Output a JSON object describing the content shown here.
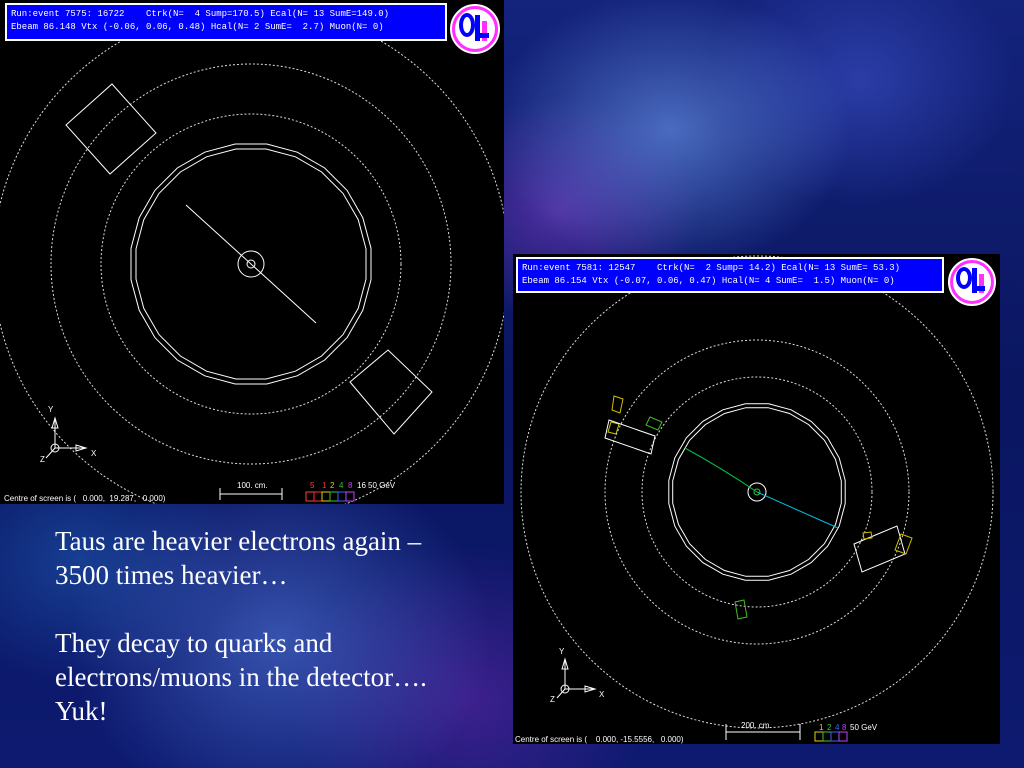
{
  "slide": {
    "paragraphs": [
      "Taus are heavier electrons again – 3500 times heavier…",
      "They decay to quarks and electrons/muons in the detector…. Yuk!"
    ]
  },
  "event1": {
    "header_line1": "Run:event 7575: 16722    Ctrk(N=  4 Sump=170.5) Ecal(N= 13 SumE=149.0)",
    "header_line2": "Ebeam 86.148 Vtx (-0.06, 0.06, 0.48) Hcal(N= 2 SumE=  2.7) Muon(N= 0)",
    "centre_of_screen": "Centre of screen is (   0.000,  19.287,   0.000)",
    "scale_label": "100. cm.",
    "energy_scale": [
      "5",
      "1",
      "2",
      "4",
      "8",
      "16",
      "50 GeV"
    ],
    "axis_labels": [
      "Y",
      "X",
      "Z"
    ]
  },
  "event2": {
    "header_line1": "Run:event 7581: 12547    Ctrk(N=  2 Sump= 14.2) Ecal(N= 13 SumE= 53.3)",
    "header_line2": "Ebeam 86.154 Vtx (-0.07, 0.06, 0.47) Hcal(N= 4 SumE=  1.5) Muon(N= 0)",
    "centre_of_screen": "Centre of screen is (    0.000, -15.5556,   0.000)",
    "scale_label": "200. cm.",
    "energy_scale": [
      "1",
      "2",
      "4",
      "8",
      "50 GeV"
    ],
    "axis_labels": [
      "Y",
      "X",
      "Z"
    ]
  },
  "colors": {
    "header_bg": "#0000ff",
    "panel_bg": "#000000",
    "slide_bg": "#0b1d6a",
    "track_green": "#00c040",
    "track_cyan": "#00c0e0",
    "cluster_yellow": "#d0c000",
    "cluster_green": "#40c020"
  },
  "icons": [
    "opal-logo-icon",
    "opal-logo-icon"
  ]
}
